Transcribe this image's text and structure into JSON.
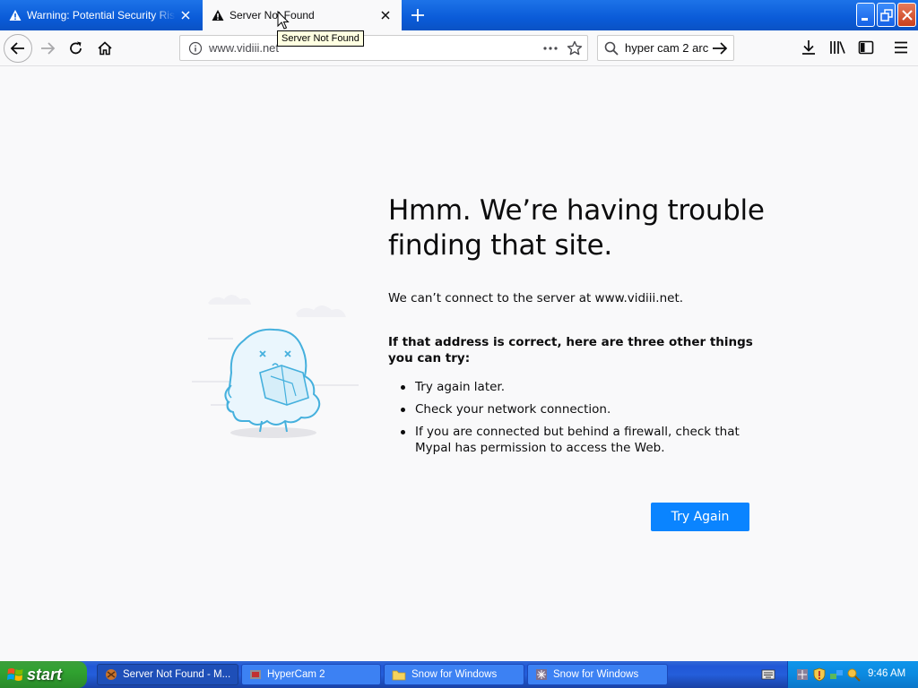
{
  "tabs": [
    {
      "title": "Warning: Potential Security Risk Ahead",
      "active": false
    },
    {
      "title": "Server Not Found",
      "active": true
    }
  ],
  "tooltip": "Server Not Found",
  "urlbar": {
    "url": "www.vidiii.net"
  },
  "searchbar": {
    "value": "hyper cam 2 arc"
  },
  "error": {
    "title": "Hmm. We’re having trouble finding that site.",
    "description": "We can’t connect to the server at www.vidiii.net.",
    "subheading": "If that address is correct, here are three other things you can try:",
    "suggestions": [
      "Try again later.",
      "Check your network connection.",
      "If you are connected but behind a firewall, check that Mypal has permission to access the Web."
    ],
    "button": "Try Again"
  },
  "taskbar": {
    "start": "start",
    "tasks": [
      {
        "label": "Server Not Found - M...",
        "icon": "browser-icon",
        "active": true
      },
      {
        "label": "HyperCam 2",
        "icon": "hypercam-icon",
        "active": false
      },
      {
        "label": "Snow for Windows",
        "icon": "folder-icon",
        "active": false
      },
      {
        "label": "Snow for Windows",
        "icon": "snow-app-icon",
        "active": false
      }
    ],
    "clock": "9:46 AM"
  },
  "colors": {
    "accent": "#0a84ff",
    "taskbar": "#245edb",
    "start": "#30a230",
    "titlebar": "#0a5bd8"
  }
}
